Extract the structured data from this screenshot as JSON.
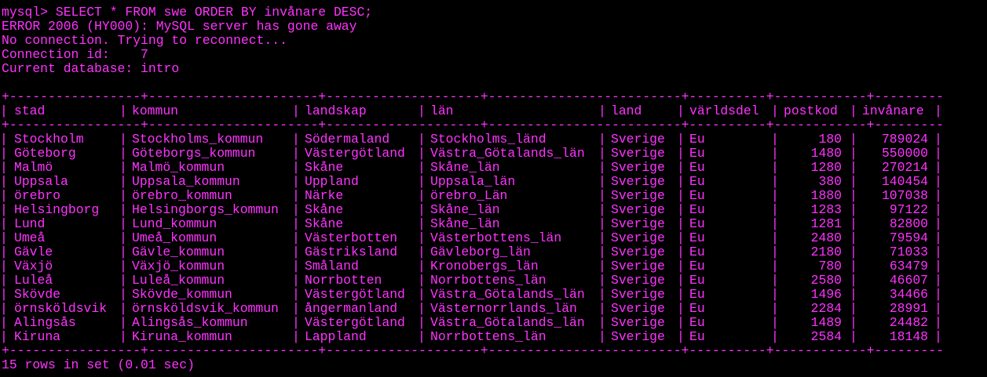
{
  "terminal": {
    "text_color": "#ff33ff",
    "background": "#000000",
    "command_line": "mysql> SELECT * FROM swe ORDER BY invånare DESC;",
    "error_line": "ERROR 2006 (HY000): MySQL server has gone away",
    "reconnect_line": "No connection. Trying to reconnect...",
    "connection_line": "Connection id:    7",
    "database_line": "Current database: intro",
    "rule_line": "+-----------------+----------------------+--------------------+-------------------------+----------+------------+----------+-----------+",
    "footer_line": "15 rows in set (0.01 sec)"
  },
  "table": {
    "columns": [
      "stad",
      "kommun",
      "landskap",
      "län",
      "land",
      "världsdel",
      "postkod",
      "invånare"
    ],
    "rows": [
      [
        "Stockholm",
        "Stockholms_kommun",
        "Södermaland",
        "Stockholms_länd",
        "Sverige",
        "Eu",
        "180",
        "789024"
      ],
      [
        "Göteborg",
        "Göteborgs_kommun",
        "Västergötland",
        "Västra_Götalands_län",
        "Sverige",
        "Eu",
        "1480",
        "550000"
      ],
      [
        "Malmö",
        "Malmö_kommun",
        "Skåne",
        "Skåne_län",
        "Sverige",
        "Eu",
        "1280",
        "270214"
      ],
      [
        "Uppsala",
        "Uppsala_kommun",
        "Uppland",
        "Uppsala_län",
        "Sverige",
        "Eu",
        "380",
        "140454"
      ],
      [
        "örebro",
        "örebro_kommun",
        "Närke",
        "örebro_Län",
        "Sverige",
        "Eu",
        "1880",
        "107038"
      ],
      [
        "Helsingborg",
        "Helsingborgs_kommun",
        "Skåne",
        "Skåne_län",
        "Sverige",
        "Eu",
        "1283",
        "97122"
      ],
      [
        "Lund",
        "Lund_kommun",
        "Skåne",
        "Skåne_län",
        "Sverige",
        "Eu",
        "1281",
        "82800"
      ],
      [
        "Umeå",
        "Umeå_kommun",
        "Västerbotten",
        "Västerbottens_län",
        "Sverige",
        "Eu",
        "2480",
        "79594"
      ],
      [
        "Gävle",
        "Gävle_kommun",
        "Gästriksland",
        "Gävleborg_län",
        "Sverige",
        "Eu",
        "2180",
        "71033"
      ],
      [
        "Växjö",
        "Växjö_kommun",
        "Småland",
        "Kronobergs_län",
        "Sverige",
        "Eu",
        "780",
        "63479"
      ],
      [
        "Luleå",
        "Luleå_kommun",
        "Norrbotten",
        "Norrbottens_län",
        "Sverige",
        "Eu",
        "2580",
        "46607"
      ],
      [
        "Skövde",
        "Skövde_kommun",
        "Västergötland",
        "Västra_Götalands_län",
        "Sverige",
        "Eu",
        "1496",
        "34466"
      ],
      [
        "örnsköldsvik",
        "örnsköldsvik_kommun",
        "ångermanland",
        "Västernorrlands_län",
        "Sverige",
        "Eu",
        "2284",
        "28991"
      ],
      [
        "Alingsås",
        "Alingsås_kommun",
        "Västergötland",
        "Västra_Götalands_län",
        "Sverige",
        "Eu",
        "1489",
        "24482"
      ],
      [
        "Kiruna",
        "Kiruna_kommun",
        "Lappland",
        "Norrbottens_län",
        "Sverige",
        "Eu",
        "2584",
        "18148"
      ]
    ]
  }
}
